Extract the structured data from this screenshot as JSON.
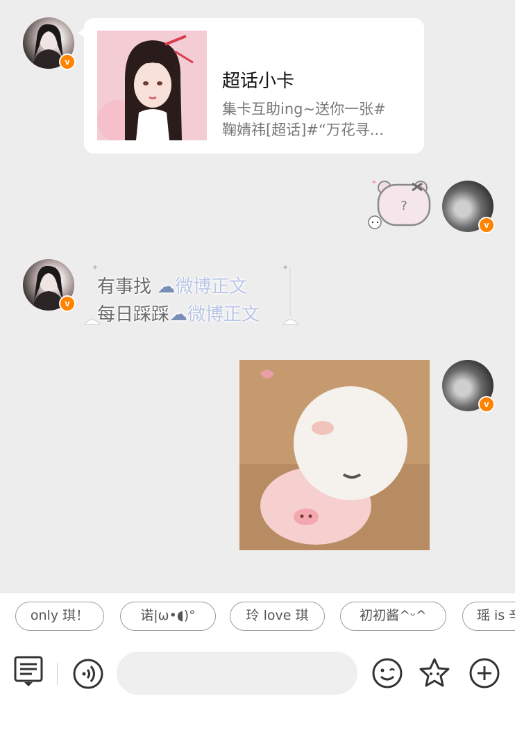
{
  "messages": {
    "card": {
      "title": "超话小卡",
      "desc_line1": "集卡互助ing~送你一张#",
      "desc_line2": "鞠婧祎[超话]#“万花寻..."
    },
    "cute_text": {
      "line1_gray": "有事找",
      "line1_blue": "微博正文",
      "line2_gray": "每日踩踩",
      "line2_blue": "微博正文"
    },
    "sticker_mark": "?"
  },
  "badge_letter": "v",
  "quick_replies": [
    "only 琪！",
    "诺|ω•◖)°",
    "玲 love 琪",
    "初初酱^ᵕ^",
    "瑶 is 辛"
  ],
  "input": {
    "placeholder": ""
  },
  "colors": {
    "verified_badge": "#ff8200",
    "chat_bg": "#ededed",
    "link_blue": "#b9c6e4"
  },
  "icons": [
    "menu-keyboard-icon",
    "voice-icon",
    "emoji-icon",
    "star-sticker-icon",
    "add-icon"
  ]
}
